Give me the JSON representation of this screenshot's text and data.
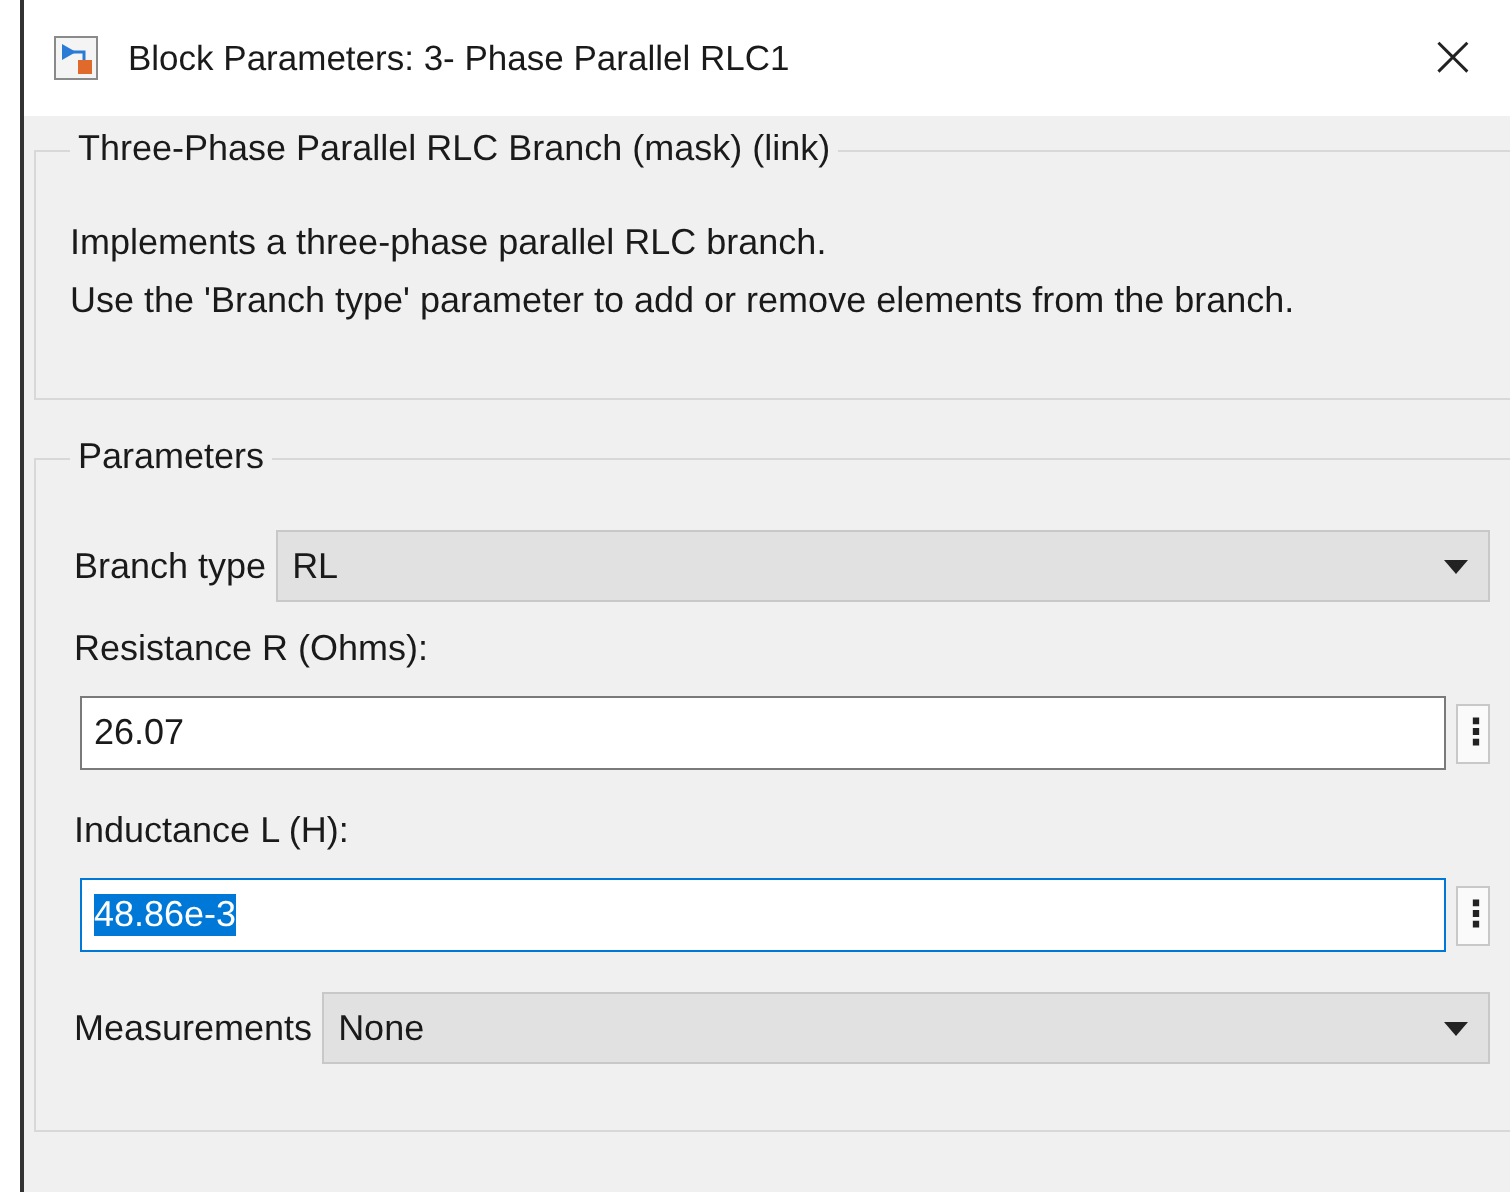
{
  "window": {
    "title": "Block Parameters: 3- Phase Parallel RLC1",
    "close": "×"
  },
  "description_group": {
    "title": "Three-Phase Parallel RLC Branch (mask) (link)",
    "lines": [
      " Implements a three-phase parallel RLC branch.",
      "Use the 'Branch type' parameter to add or remove elements from the branch."
    ]
  },
  "parameters_group": {
    "title": "Parameters",
    "fields": [
      {
        "kind": "dropdown",
        "label": "Branch type",
        "value": "RL"
      },
      {
        "kind": "text",
        "label": "Resistance R (Ohms):",
        "value": "26.07",
        "focused": false,
        "more": "⋮"
      },
      {
        "kind": "text",
        "label": "Inductance L (H):",
        "value": "48.86e-3",
        "focused": true,
        "more": "⋮"
      },
      {
        "kind": "dropdown",
        "label": "Measurements",
        "value": "None"
      }
    ]
  }
}
